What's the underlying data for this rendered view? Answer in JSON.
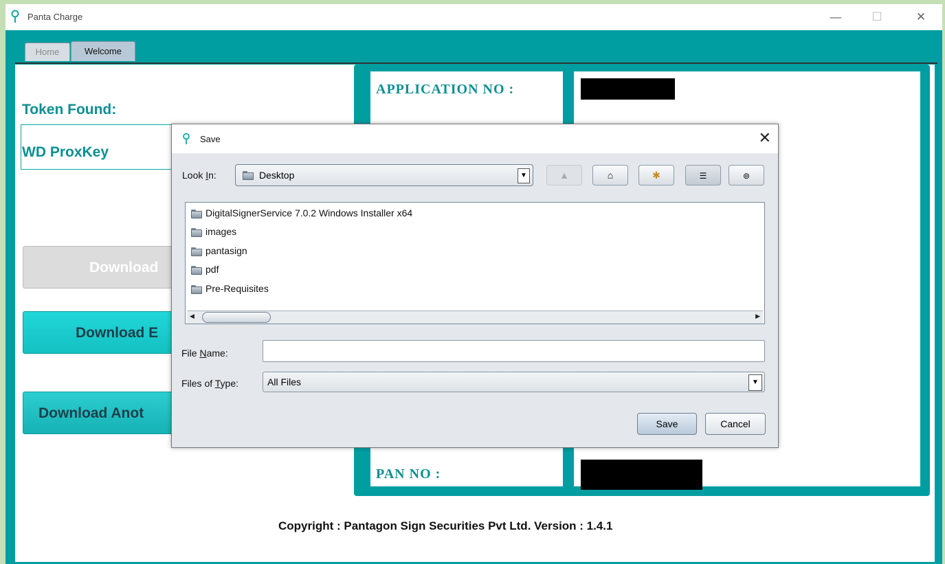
{
  "window": {
    "title": "Panta Charge",
    "minimize": "—",
    "maximize": "☐",
    "close": "✕"
  },
  "tabs": [
    {
      "label": "Home"
    },
    {
      "label": "Welcome"
    }
  ],
  "left_panel": {
    "token_label": "Token Found:",
    "token_value": "WD ProxKey",
    "buttons": [
      {
        "label": "Download"
      },
      {
        "label": "Download E"
      },
      {
        "label": "Download Anot"
      }
    ]
  },
  "info": {
    "application_label": "APPLICATION NO :",
    "pan_label": "PAN NO :"
  },
  "footer": {
    "copyright": "Copyright : Pantagon Sign Securities Pvt Ltd.  Version : 1.4.1"
  },
  "dialog": {
    "title": "Save",
    "look_in_label_pre": "Look ",
    "look_in_label_u": "I",
    "look_in_label_post": "n:",
    "look_in_value": "Desktop",
    "toolbar_icons": [
      "up-folder-icon",
      "home-icon",
      "new-folder-icon",
      "list-view-icon",
      "details-view-icon"
    ],
    "files": [
      {
        "name": "DigitalSignerService 7.0.2 Windows Installer x64"
      },
      {
        "name": "images"
      },
      {
        "name": "pantasign"
      },
      {
        "name": "pdf"
      },
      {
        "name": "Pre-Requisites"
      }
    ],
    "file_name_label_pre": "File ",
    "file_name_label_u": "N",
    "file_name_label_post": "ame:",
    "file_name_value": "",
    "files_type_label_pre": "Files of ",
    "files_type_label_u": "T",
    "files_type_label_post": "ype:",
    "files_type_value": "All Files",
    "save_label": "Save",
    "cancel_label": "Cancel"
  }
}
